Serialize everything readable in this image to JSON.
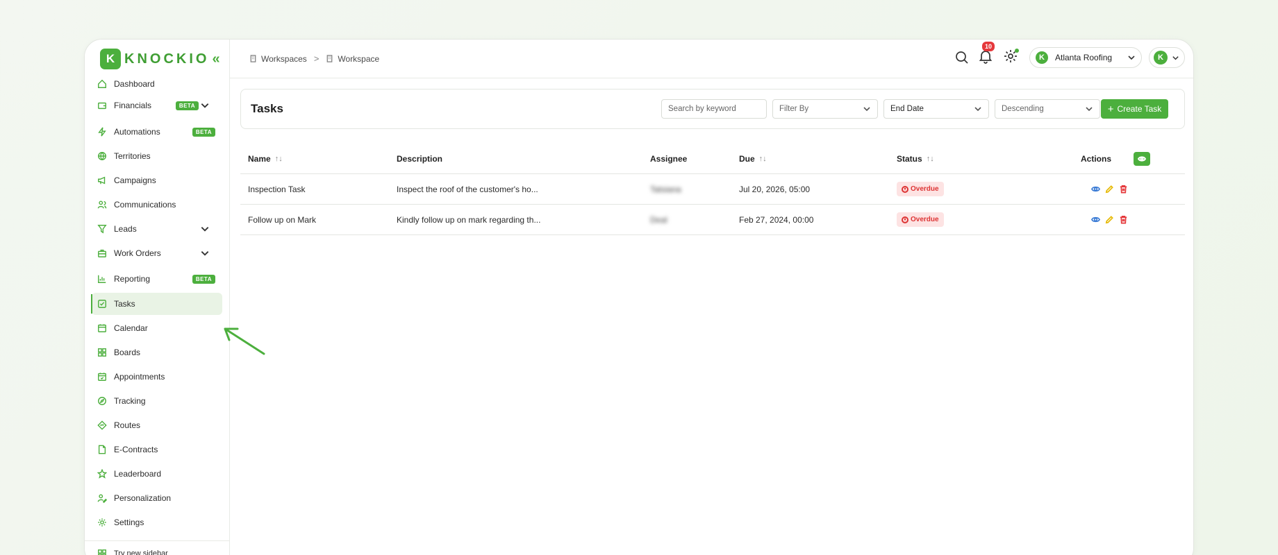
{
  "brand": {
    "logo_letter": "K",
    "logo_text": "KNOCKIO",
    "collapse_glyph": "«",
    "accent": "#4caf3d"
  },
  "sidebar": {
    "items": [
      {
        "label": "Dashboard",
        "icon": "home-icon"
      },
      {
        "label": "Financials",
        "icon": "wallet-icon",
        "badge": "BETA",
        "expandable": true
      },
      {
        "label": "Automations",
        "icon": "bolt-icon",
        "badge": "BETA"
      },
      {
        "label": "Territories",
        "icon": "globe-icon"
      },
      {
        "label": "Campaigns",
        "icon": "megaphone-icon"
      },
      {
        "label": "Communications",
        "icon": "people-icon"
      },
      {
        "label": "Leads",
        "icon": "funnel-icon",
        "expandable": true
      },
      {
        "label": "Work Orders",
        "icon": "briefcase-icon",
        "expandable": true
      },
      {
        "label": "Reporting",
        "icon": "chart-icon",
        "badge": "BETA"
      },
      {
        "label": "Tasks",
        "icon": "checkbox-icon",
        "active": true
      },
      {
        "label": "Calendar",
        "icon": "calendar-icon"
      },
      {
        "label": "Boards",
        "icon": "grid-icon"
      },
      {
        "label": "Appointments",
        "icon": "calendar-check-icon"
      },
      {
        "label": "Tracking",
        "icon": "compass-icon"
      },
      {
        "label": "Routes",
        "icon": "route-icon"
      },
      {
        "label": "E-Contracts",
        "icon": "document-icon"
      },
      {
        "label": "Leaderboard",
        "icon": "star-icon"
      },
      {
        "label": "Personalization",
        "icon": "user-edit-icon"
      },
      {
        "label": "Settings",
        "icon": "gear-icon"
      }
    ],
    "footer": {
      "label": "Try new sidebar",
      "icon": "grid-icon"
    }
  },
  "breadcrumb": {
    "items": [
      "Workspaces",
      "Workspace"
    ],
    "separator": ">"
  },
  "topbar": {
    "notification_count": "10",
    "org_name": "Atlanta Roofing",
    "avatar_letter": "K"
  },
  "tasks_page": {
    "title": "Tasks",
    "search_placeholder": "Search by keyword",
    "filter_label": "Filter By",
    "date_label": "End Date",
    "sort_label": "Descending",
    "create_label": "Create Task",
    "columns": [
      "Name",
      "Description",
      "Assignee",
      "Due",
      "Status",
      "Actions"
    ],
    "rows": [
      {
        "name": "Inspection Task",
        "description": "Inspect the roof of the customer's ho...",
        "assignee": "Tatsiana",
        "due": "Jul 20, 2026, 05:00",
        "status": "Overdue"
      },
      {
        "name": "Follow up on Mark",
        "description": "Kindly follow up on mark regarding th...",
        "assignee": "Deal",
        "due": "Feb 27, 2024, 00:00",
        "status": "Overdue"
      }
    ]
  },
  "colors": {
    "accent": "#4caf3d",
    "overdue_bg": "#fde3e3",
    "overdue_text": "#d33333"
  }
}
